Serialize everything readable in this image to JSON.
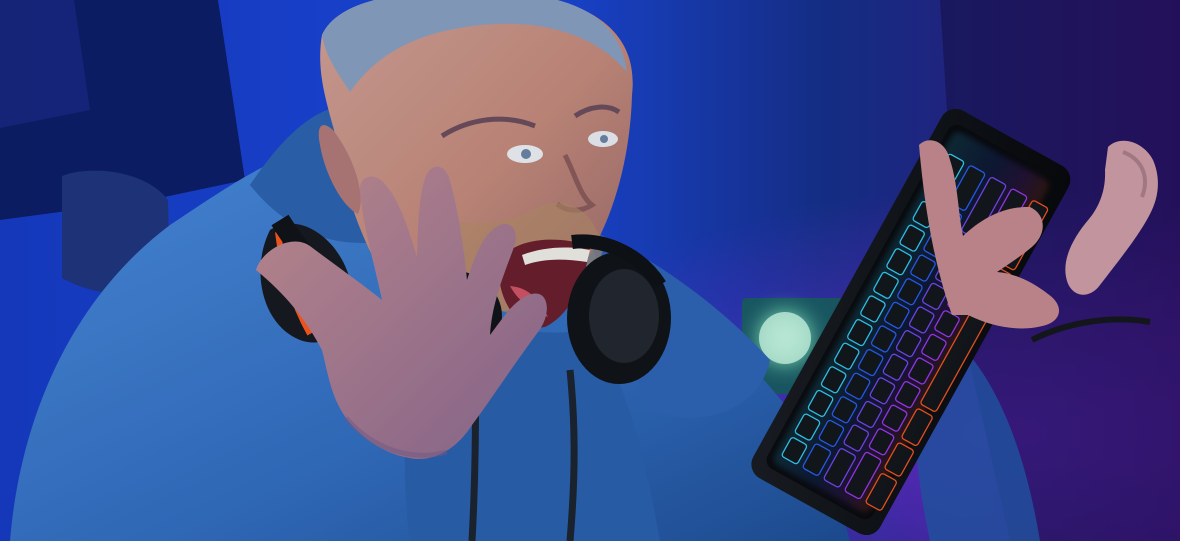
{
  "photo": {
    "subject": "person-with-headphones-and-keyboard",
    "palette": {
      "background_dark": "#0b1230",
      "background_blue": "#1f4de0",
      "ambient_purple": "#6a1aa8",
      "hoodie": "#3a78c8",
      "hoodie_shadow": "#1f4f98",
      "skin": "#c98f80",
      "hair": "#7d94b8",
      "headphones": "#111418",
      "headphone_accent": "#ff5a1f",
      "keyboard": "#0f1114",
      "key_glow_cyan": "#35d6ff",
      "key_glow_blue": "#2c63ff",
      "key_glow_purple": "#a33cff",
      "key_glow_orange": "#ff5a22",
      "monitor_glow": "#8df3c7"
    }
  }
}
